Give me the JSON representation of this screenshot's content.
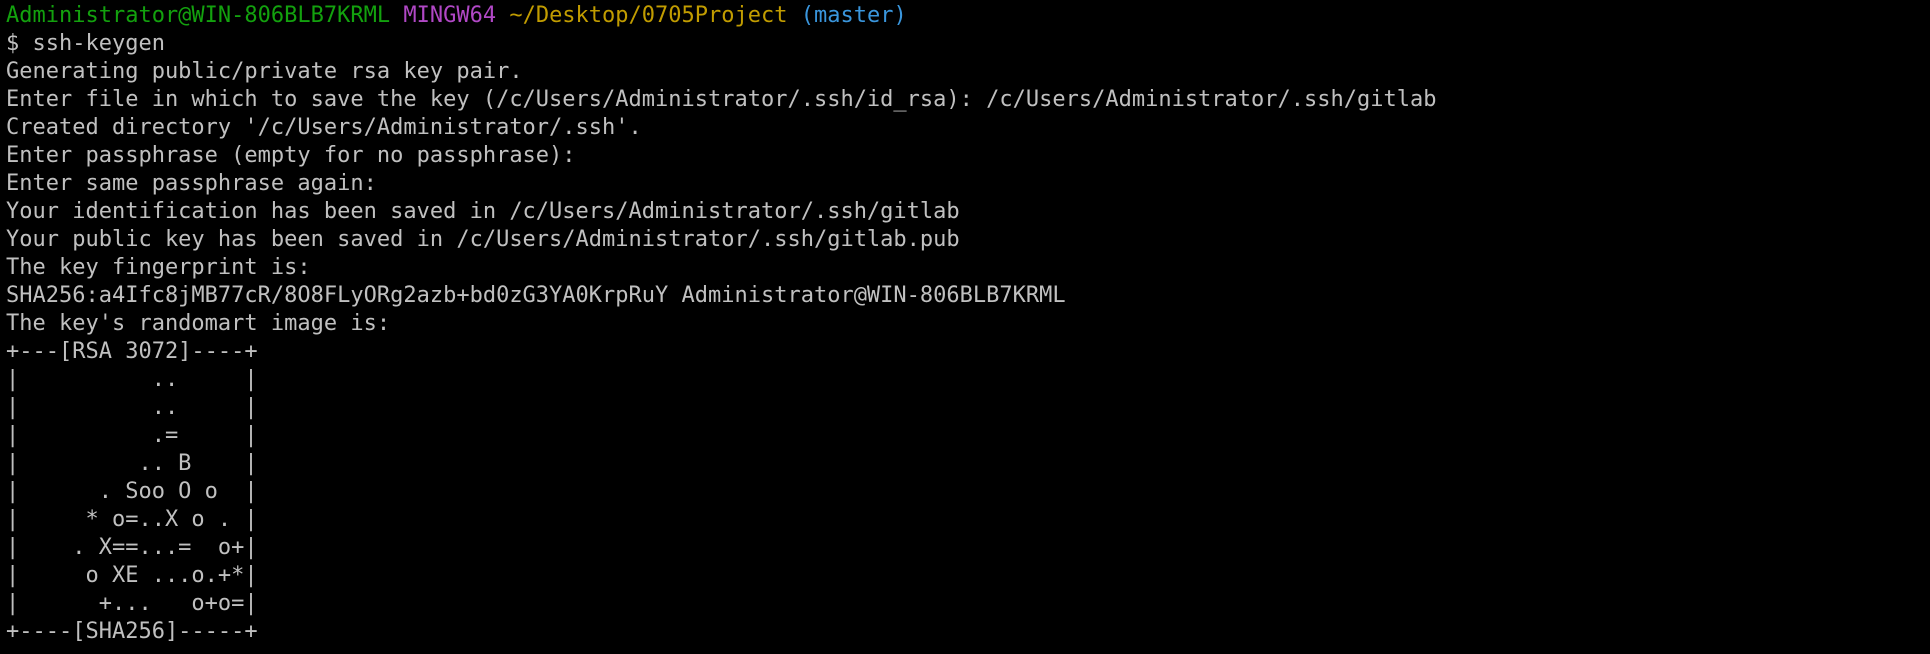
{
  "prompt": {
    "user_host": "Administrator@WIN-806BLB7KRML",
    "system": "MINGW64",
    "path": "~/Desktop/0705Project",
    "branch": "(master)",
    "symbol": "$",
    "command": "ssh-keygen"
  },
  "colors": {
    "background": "#000000",
    "text": "#c0c0c0",
    "user_host": "#13a10e",
    "system": "#b148c6",
    "path": "#c19c00",
    "branch": "#3a96dd"
  },
  "output": [
    "Generating public/private rsa key pair.",
    "Enter file in which to save the key (/c/Users/Administrator/.ssh/id_rsa): /c/Users/Administrator/.ssh/gitlab",
    "Created directory '/c/Users/Administrator/.ssh'.",
    "Enter passphrase (empty for no passphrase):",
    "Enter same passphrase again:",
    "Your identification has been saved in /c/Users/Administrator/.ssh/gitlab",
    "Your public key has been saved in /c/Users/Administrator/.ssh/gitlab.pub",
    "The key fingerprint is:",
    "SHA256:a4Ifc8jMB77cR/8O8FLyORg2azb+bd0zG3YA0KrpRuY Administrator@WIN-806BLB7KRML",
    "The key's randomart image is:",
    "+---[RSA 3072]----+",
    "|          ..     |",
    "|          ..     |",
    "|          .=     |",
    "|         .. B    |",
    "|      . Soo O o  |",
    "|     * o=..X o . |",
    "|    . X==...=  o+|",
    "|     o XE ...o.+*|",
    "|      +...   o+o=|",
    "+----[SHA256]-----+"
  ]
}
